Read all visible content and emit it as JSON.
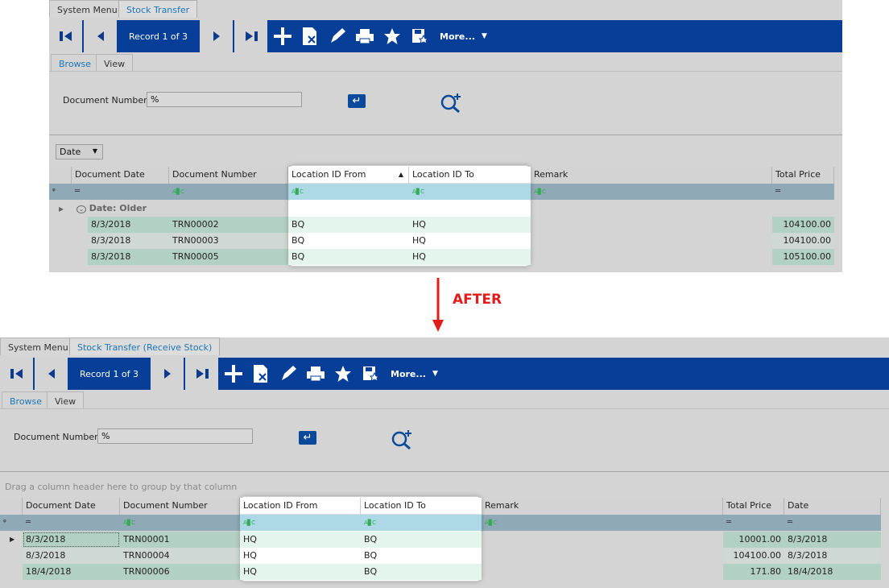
{
  "before": {
    "tabs": [
      "System Menu",
      "Stock Transfer"
    ],
    "toolbar": {
      "record": "Record 1 of 3",
      "more": "More..."
    },
    "subtabs": [
      "Browse",
      "View"
    ],
    "doc_label": "Document Number",
    "doc_value": "%",
    "group_dropdown": "Date",
    "columns": [
      "Document Date",
      "Document Number",
      "Location ID From",
      "Location ID To",
      "Remark",
      "Total Price"
    ],
    "group_label": "Date: Older",
    "rows": [
      {
        "date": "8/3/2018",
        "num": "TRN00002",
        "from": "BQ",
        "to": "HQ",
        "remark": "",
        "price": "104100.00"
      },
      {
        "date": "8/3/2018",
        "num": "TRN00003",
        "from": "BQ",
        "to": "HQ",
        "remark": "",
        "price": "104100.00"
      },
      {
        "date": "8/3/2018",
        "num": "TRN00005",
        "from": "BQ",
        "to": "HQ",
        "remark": "",
        "price": "105100.00"
      }
    ]
  },
  "arrow_label": "AFTER",
  "after": {
    "tabs": [
      "System Menu",
      "Stock Transfer (Receive Stock)"
    ],
    "toolbar": {
      "record": "Record 1 of 3",
      "more": "More..."
    },
    "subtabs": [
      "Browse",
      "View"
    ],
    "doc_label": "Document Number",
    "doc_value": "%",
    "group_hint": "Drag a column header here to group by that column",
    "columns": [
      "Document Date",
      "Document Number",
      "Location ID From",
      "Location ID To",
      "Remark",
      "Total Price",
      "Date"
    ],
    "rows": [
      {
        "date": "8/3/2018",
        "num": "TRN00001",
        "from": "HQ",
        "to": "BQ",
        "remark": "",
        "price": "10001.00",
        "date2": "8/3/2018"
      },
      {
        "date": "8/3/2018",
        "num": "TRN00004",
        "from": "HQ",
        "to": "BQ",
        "remark": "",
        "price": "104100.00",
        "date2": "8/3/2018"
      },
      {
        "date": "18/4/2018",
        "num": "TRN00006",
        "from": "HQ",
        "to": "BQ",
        "remark": "",
        "price": "171.80",
        "date2": "18/4/2018"
      }
    ]
  }
}
